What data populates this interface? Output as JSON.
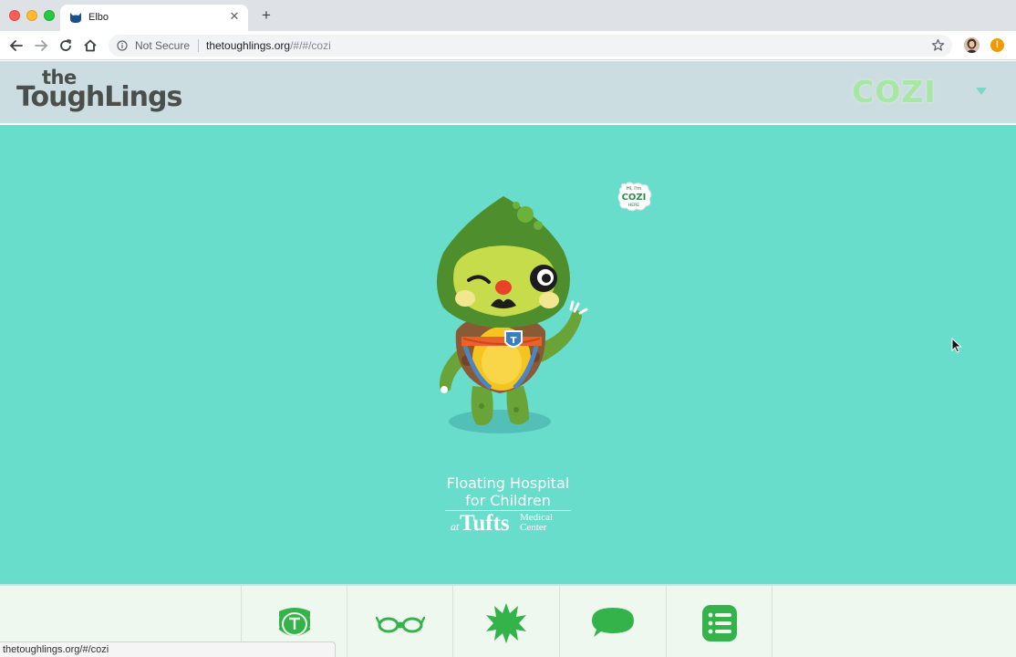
{
  "browser": {
    "tab_title": "Elbo",
    "tab_favicon": "cat-head-icon",
    "new_tab_label": "+",
    "security_label": "Not Secure",
    "url_host": "thetoughlings.org",
    "url_path": "/#/#/cozi",
    "status_url": "thetoughlings.org/#/cozi"
  },
  "header": {
    "logo_small": "the",
    "logo_main": "ToughLings",
    "character_name": "COZI"
  },
  "stage": {
    "sticker_line1": "Hi, I'm",
    "sticker_line2": "COZI",
    "sticker_line3": "HERE",
    "hospital_line1": "Floating Hospital",
    "hospital_line2": "for Children",
    "hospital_at": "at",
    "hospital_tufts": "Tufts",
    "hospital_medical": "Medical",
    "hospital_center": "Center"
  },
  "bottom_nav": [
    {
      "icon": "turtle-shell-icon"
    },
    {
      "icon": "glasses-icon"
    },
    {
      "icon": "starburst-icon"
    },
    {
      "icon": "speech-bubble-icon"
    },
    {
      "icon": "list-icon"
    }
  ],
  "colors": {
    "stage_bg": "#68ddcc",
    "header_bg": "#cbdde0",
    "nav_icon": "#33b34a",
    "character_name": "#a8e6a5"
  }
}
